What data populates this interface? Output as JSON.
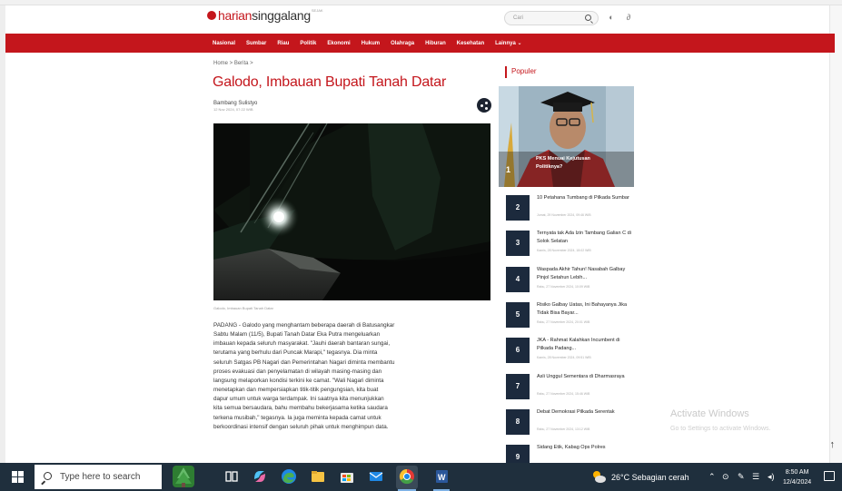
{
  "site": {
    "logo_text_red": "harian",
    "logo_text_dark": "singgalang",
    "logo_sup": "SEJAK",
    "search_placeholder": "Cari"
  },
  "nav": {
    "items": [
      "Nasional",
      "Sumbar",
      "Riau",
      "Politik",
      "Ekonomi",
      "Hukum",
      "Olahraga",
      "Hiburan",
      "Kesehatan",
      "Lainnya ⌄"
    ]
  },
  "article": {
    "breadcrumb": "Home > Berita >",
    "title": "Galodo, Imbauan Bupati Tanah Datar",
    "author": "Bambang Sulistyo",
    "date": "12 Nov 2024, 07:22 WIB",
    "caption": "Galodo, Imbauan Bupati Tanah Datar",
    "body_lines": [
      "PADANG - Galodo yang menghantam beberapa daerah di Batusangkar",
      "Sabtu Malam (11/5), Bupati Tanah Datar Eka Putra mengeluarkan",
      "imbauan kepada seluruh masyarakat. \"Jauhi daerah bantaran sungai,",
      "terutama yang berhulu dari Puncak Marapi,\" tegasnya. Dia minta",
      "seluruh Satgas PB Nagari dan Pemerintahan Nagari diminta membantu",
      "proses evakuasi dan penyelamatan di wilayah masing-masing dan",
      "langsung melaporkan kondisi terkini ke camat. \"Wali Nagari diminta",
      "menetapkan dan mempersiapkan titik-titik pengungsian, kita buat",
      "dapur umum untuk warga terdampak. Ini saatnya kita menunjukkan",
      "kita semua bersaudara, bahu membahu bekerjasama ketika saudara",
      "terkena musibah,\" tegasnya. Ia juga meminta kepada camat untuk",
      "berkoordinasi intensif dengan seluruh pihak untuk menghimpun data."
    ]
  },
  "popular": {
    "heading": "Populer",
    "featured": {
      "rank": "1",
      "title": "PKS Menuai Kejutusan Politiknya?"
    },
    "items": [
      {
        "rank": "2",
        "title": "10 Petahana Tumbang di Pilkada Sumbar",
        "date": "Jumat, 29 November 2024, 09:46 WIB"
      },
      {
        "rank": "3",
        "title": "Ternyata tak Ada Izin Tambang Galian C di Solok Selatan",
        "date": "Kamis, 28 November 2024, 18:02 WIB"
      },
      {
        "rank": "4",
        "title": "Waspada Akhir Tahun! Nasabah Galbay Pinjol Setahun Lebih...",
        "date": "Rabu, 27 November 2024, 10:09 WIB"
      },
      {
        "rank": "5",
        "title": "Risiko Galbay Uatas, Ini Bahayanya Jika Tidak Bisa Bayar...",
        "date": "Rabu, 27 November 2024, 20:01 WIB"
      },
      {
        "rank": "6",
        "title": "JKA - Rahmat Kalahkan Incumbent di Pilkada Padang...",
        "date": "Kamis, 28 November 2024, 09:51 WIB"
      },
      {
        "rank": "7",
        "title": "Asli Unggul Sementara di Dharmasraya",
        "date": "Rabu, 27 November 2024, 15:46 WIB"
      },
      {
        "rank": "8",
        "title": "Debat Demokrasi Pilkada Serentak",
        "date": "Rabu, 27 November 2024, 13:12 WIB"
      },
      {
        "rank": "9",
        "title": "Sidang Etik, Kabag Ops Polres",
        "date": ""
      }
    ]
  },
  "watermark": {
    "title": "Activate Windows",
    "subtitle": "Go to Settings to activate Windows."
  },
  "taskbar": {
    "search_placeholder": "Type here to search",
    "weather": "26°C  Sebagian cerah",
    "time": "8:50 AM",
    "date": "12/4/2024"
  },
  "colors": {
    "brand_red": "#c4161c",
    "rank_navy": "#1c2a3d",
    "taskbar": "#1f2f3d"
  }
}
